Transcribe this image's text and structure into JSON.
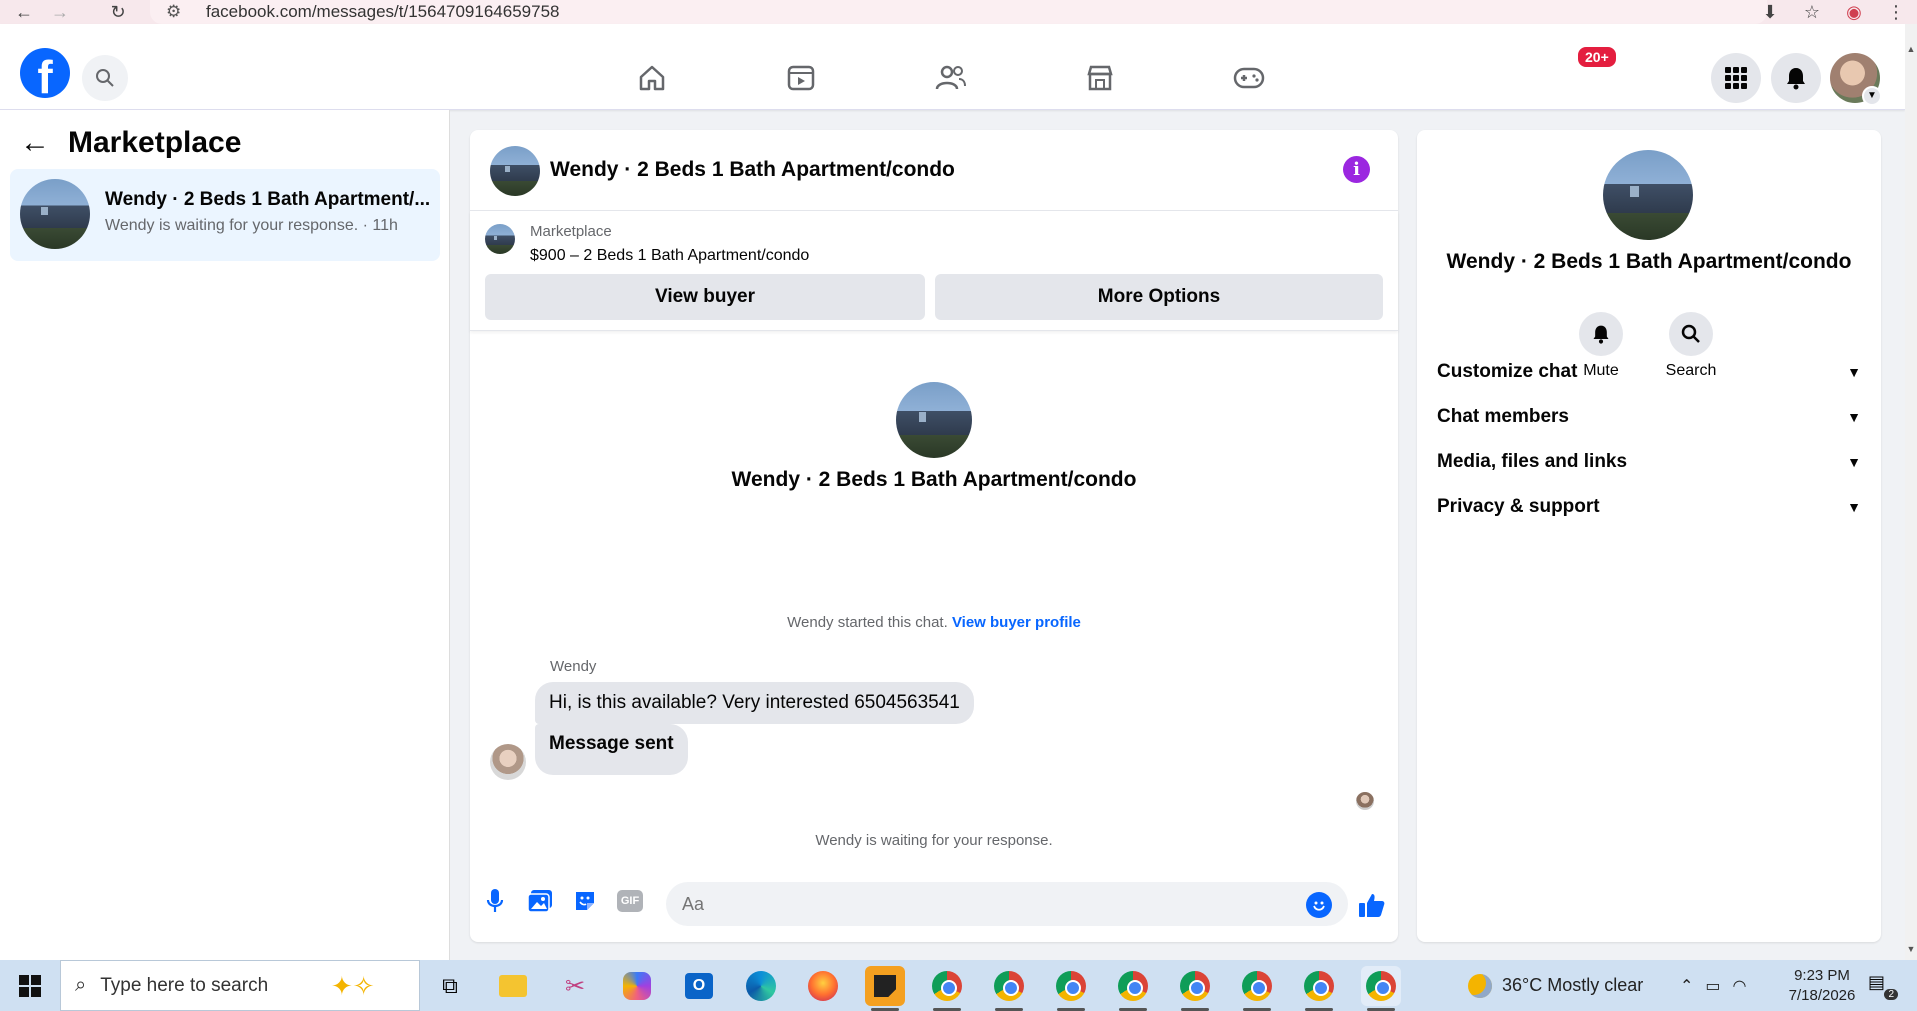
{
  "browser": {
    "url": "facebook.com/messages/t/1564709164659758"
  },
  "header": {
    "notification_badge": "20+"
  },
  "left_panel": {
    "title": "Marketplace",
    "conversation": {
      "title": "Wendy · 2 Beds 1 Bath Apartment/...",
      "subtitle": "Wendy is waiting for your response. · 11h"
    }
  },
  "chat": {
    "header_title": "Wendy · 2 Beds 1 Bath Apartment/condo",
    "marketplace_label": "Marketplace",
    "listing": "$900 – 2 Beds 1 Bath Apartment/condo",
    "view_buyer_label": "View buyer",
    "more_options_label": "More Options",
    "center_title": "Wendy · 2 Beds 1 Bath Apartment/condo",
    "started_text": "Wendy started this chat.",
    "view_profile_link": "View buyer profile",
    "sender_name": "Wendy",
    "messages": [
      "Hi, is this available? Very interested 6504563541",
      "Message sent"
    ],
    "waiting_text": "Wendy is waiting for your response.",
    "input_placeholder": "Aa"
  },
  "right_panel": {
    "title": "Wendy · 2 Beds 1 Bath Apartment/condo",
    "mute_label": "Mute",
    "search_label": "Search",
    "sections": [
      "Customize chat",
      "Chat members",
      "Media, files and links",
      "Privacy & support"
    ]
  },
  "taskbar": {
    "search_placeholder": "Type here to search",
    "weather": "36°C  Mostly clear",
    "time": "9:23 PM",
    "date": "7/18/2026",
    "notification_count": "2"
  },
  "colors": {
    "facebook_blue": "#0866ff",
    "info_purple": "#9b27e0",
    "badge_red": "#e41e3f",
    "selected_bg": "#ebf5ff"
  }
}
